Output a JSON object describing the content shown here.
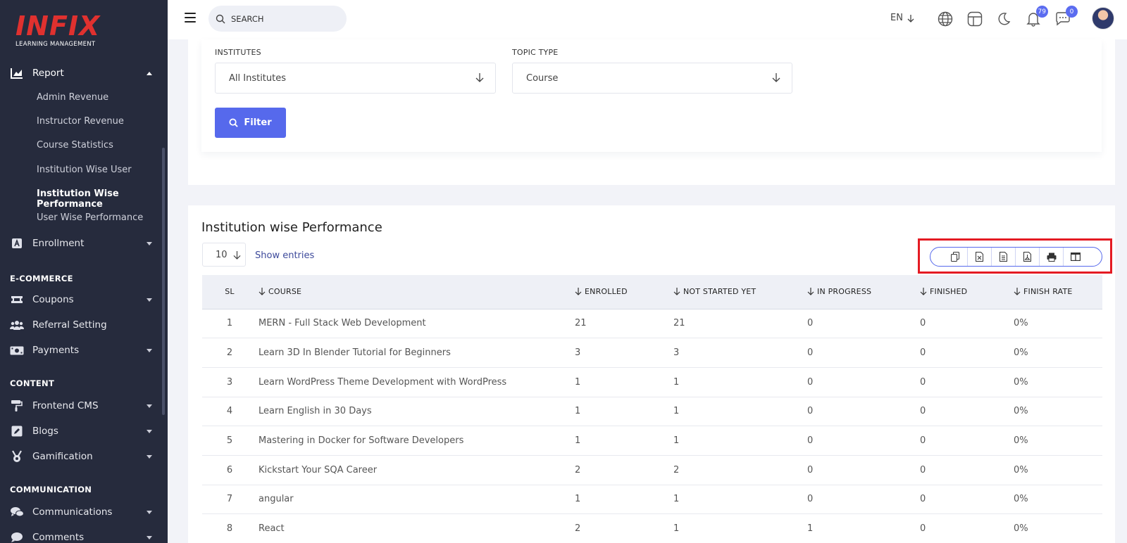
{
  "brand": {
    "logo_text": "INFIX",
    "logo_sub": "LEARNING MANAGEMENT"
  },
  "sidebar": {
    "report": {
      "label": "Report"
    },
    "report_items": [
      {
        "label": "Admin Revenue"
      },
      {
        "label": "Instructor Revenue"
      },
      {
        "label": "Course Statistics"
      },
      {
        "label": "Institution Wise User"
      },
      {
        "label": "Institution Wise Performance"
      },
      {
        "label": "User Wise Performance"
      }
    ],
    "enrollment": {
      "label": "Enrollment"
    },
    "ecommerce_title": "E-COMMERCE",
    "coupons": {
      "label": "Coupons"
    },
    "referral": {
      "label": "Referral Setting"
    },
    "payments": {
      "label": "Payments"
    },
    "content_title": "CONTENT",
    "frontend_cms": {
      "label": "Frontend CMS"
    },
    "blogs": {
      "label": "Blogs"
    },
    "gamification": {
      "label": "Gamification"
    },
    "communication_title": "COMMUNICATION",
    "communications": {
      "label": "Communications"
    },
    "comments": {
      "label": "Comments"
    }
  },
  "topbar": {
    "search_placeholder": "SEARCH",
    "language": "EN",
    "notification_count": "79",
    "message_count": "0"
  },
  "filter": {
    "institutes_label": "INSTITUTES",
    "institutes_value": "All Institutes",
    "topic_type_label": "TOPIC TYPE",
    "topic_type_value": "Course",
    "button_label": "Filter"
  },
  "table": {
    "title": "Institution wise Performance",
    "page_size": "10",
    "show_entries": "Show entries",
    "columns": {
      "sl": "SL",
      "course": "COURSE",
      "enrolled": "ENROLLED",
      "not_started": "NOT STARTED YET",
      "in_progress": "IN PROGRESS",
      "finished": "FINISHED",
      "finish_rate": "FINISH RATE"
    },
    "rows": [
      {
        "sl": "1",
        "course": "MERN - Full Stack Web Development",
        "enrolled": "21",
        "not_started": "21",
        "in_progress": "0",
        "finished": "0",
        "rate": "0%"
      },
      {
        "sl": "2",
        "course": "Learn 3D In Blender Tutorial for Beginners",
        "enrolled": "3",
        "not_started": "3",
        "in_progress": "0",
        "finished": "0",
        "rate": "0%"
      },
      {
        "sl": "3",
        "course": "Learn WordPress Theme Development with WordPress",
        "enrolled": "1",
        "not_started": "1",
        "in_progress": "0",
        "finished": "0",
        "rate": "0%"
      },
      {
        "sl": "4",
        "course": "Learn English in 30 Days",
        "enrolled": "1",
        "not_started": "1",
        "in_progress": "0",
        "finished": "0",
        "rate": "0%"
      },
      {
        "sl": "5",
        "course": "Mastering in Docker for Software Developers",
        "enrolled": "1",
        "not_started": "1",
        "in_progress": "0",
        "finished": "0",
        "rate": "0%"
      },
      {
        "sl": "6",
        "course": "Kickstart Your SQA Career",
        "enrolled": "2",
        "not_started": "2",
        "in_progress": "0",
        "finished": "0",
        "rate": "0%"
      },
      {
        "sl": "7",
        "course": "angular",
        "enrolled": "1",
        "not_started": "1",
        "in_progress": "0",
        "finished": "0",
        "rate": "0%"
      },
      {
        "sl": "8",
        "course": "React",
        "enrolled": "2",
        "not_started": "1",
        "in_progress": "1",
        "finished": "0",
        "rate": "0%"
      }
    ]
  },
  "colors": {
    "sidebar_bg": "#262b3d",
    "accent": "#5669ec",
    "brand_red": "#e0312f",
    "highlight_box": "#e41b23"
  },
  "icons": {
    "export": [
      "copy-icon",
      "excel-icon",
      "csv-icon",
      "pdf-icon",
      "print-icon",
      "columns-icon"
    ]
  }
}
